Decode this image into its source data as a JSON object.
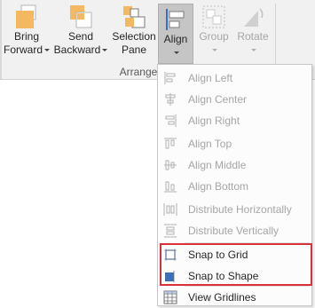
{
  "ribbon": {
    "bring_forward": {
      "line1": "Bring",
      "line2": "Forward"
    },
    "send_backward": {
      "line1": "Send",
      "line2": "Backward"
    },
    "selection_pane": {
      "line1": "Selection",
      "line2": "Pane"
    },
    "align": {
      "label": "Align"
    },
    "group": {
      "label": "Group"
    },
    "rotate": {
      "label": "Rotate"
    },
    "group_label": "Arrange"
  },
  "menu": {
    "items": [
      {
        "label": "Align Left",
        "enabled": false,
        "icon": "align-left-icon"
      },
      {
        "label": "Align Center",
        "enabled": false,
        "icon": "align-center-icon"
      },
      {
        "label": "Align Right",
        "enabled": false,
        "icon": "align-right-icon"
      },
      {
        "label": "Align Top",
        "enabled": false,
        "icon": "align-top-icon"
      },
      {
        "label": "Align Middle",
        "enabled": false,
        "icon": "align-middle-icon"
      },
      {
        "label": "Align Bottom",
        "enabled": false,
        "icon": "align-bottom-icon"
      },
      {
        "label": "Distribute Horizontally",
        "enabled": false,
        "icon": "distribute-horizontally-icon"
      },
      {
        "label": "Distribute Vertically",
        "enabled": false,
        "icon": "distribute-vertically-icon"
      },
      {
        "label": "Snap to Grid",
        "enabled": true,
        "icon": "snap-to-grid-icon"
      },
      {
        "label": "Snap to Shape",
        "enabled": true,
        "icon": "snap-to-shape-icon"
      },
      {
        "label": "View Gridlines",
        "enabled": true,
        "icon": "view-gridlines-icon"
      }
    ]
  },
  "colors": {
    "accent_orange": "#f4b860",
    "highlight_red": "#d9313c",
    "icon_blue": "#3c6fb4"
  }
}
